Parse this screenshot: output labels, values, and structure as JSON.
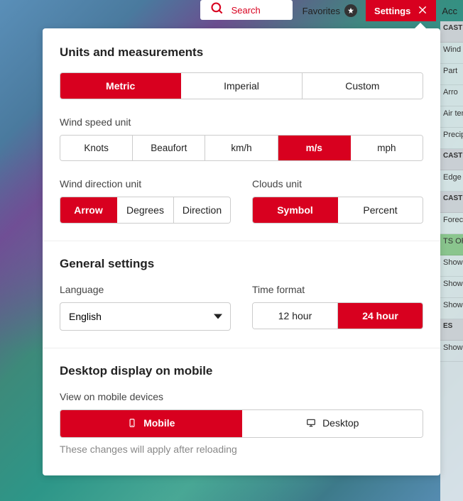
{
  "topbar": {
    "search_placeholder": "Search",
    "favorites_label": "Favorites",
    "settings_label": "Settings",
    "account_label": "Acc"
  },
  "sections": {
    "units_title": "Units and measurements",
    "general_title": "General settings",
    "desktop_title": "Desktop display on mobile"
  },
  "unit_system": {
    "options": [
      "Metric",
      "Imperial",
      "Custom"
    ],
    "selected": "Metric"
  },
  "wind_speed": {
    "label": "Wind speed unit",
    "options": [
      "Knots",
      "Beaufort",
      "km/h",
      "m/s",
      "mph"
    ],
    "selected": "m/s"
  },
  "wind_direction": {
    "label": "Wind direction unit",
    "options": [
      "Arrow",
      "Degrees",
      "Direction"
    ],
    "selected": "Arrow"
  },
  "clouds": {
    "label": "Clouds unit",
    "options": [
      "Symbol",
      "Percent"
    ],
    "selected": "Symbol"
  },
  "language": {
    "label": "Language",
    "selected": "English"
  },
  "time_format": {
    "label": "Time format",
    "options": [
      "12 hour",
      "24 hour"
    ],
    "selected": "24 hour"
  },
  "mobile_view": {
    "label": "View on mobile devices",
    "options": [
      "Mobile",
      "Desktop"
    ],
    "selected": "Mobile",
    "hint": "These changes will apply after reloading"
  },
  "side_items": [
    "CAST",
    "Wind s",
    "Part",
    "Arro",
    "Air ten",
    "Precip",
    "CAST",
    "Edge",
    "CAST",
    "Foreca",
    "TS OF",
    "Show",
    "Show",
    "Show",
    "ES",
    "Show"
  ],
  "colors": {
    "brand": "#d8001f"
  }
}
